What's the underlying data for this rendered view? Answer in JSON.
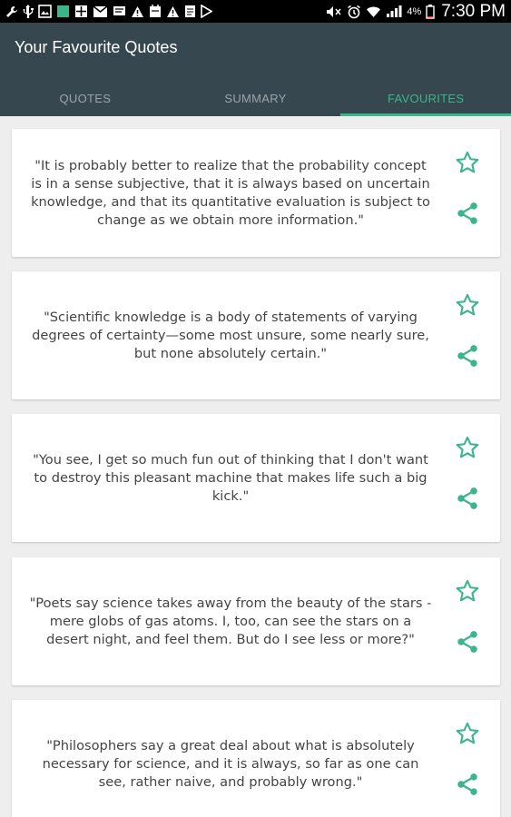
{
  "status_bar": {
    "battery": "4%",
    "time": "7:30 PM"
  },
  "app": {
    "title": "Your Favourite Quotes"
  },
  "tabs": [
    {
      "label": "QUOTES",
      "active": false
    },
    {
      "label": "SUMMARY",
      "active": false
    },
    {
      "label": "FAVOURITES",
      "active": true
    }
  ],
  "colors": {
    "appbar": "#37474f",
    "accent": "#3db58a"
  },
  "quotes": [
    {
      "text": "\"It is probably better to realize that the probability concept is in a sense subjective, that it is always based on uncertain knowledge, and that its quantitative evaluation is subject to change as we obtain more information.\"",
      "favourite_icon": "star-outline-icon",
      "share_icon": "share-icon"
    },
    {
      "text": "\"Scientific knowledge is a body of statements of varying degrees of certainty—some most unsure, some nearly sure, but none absolutely certain.\"",
      "favourite_icon": "star-outline-icon",
      "share_icon": "share-icon"
    },
    {
      "text": "\"You see, I get so much fun out of thinking that I don't want to destroy this pleasant machine that makes life such a big kick.\"",
      "favourite_icon": "star-outline-icon",
      "share_icon": "share-icon"
    },
    {
      "text": "\"Poets say science takes away from the beauty of the stars - mere globs of gas atoms. I, too, can see the stars on a desert night, and feel them. But do I see less or more?\"",
      "favourite_icon": "star-outline-icon",
      "share_icon": "share-icon"
    },
    {
      "text": "\"Philosophers say a great deal about what is absolutely necessary for science, and it is always, so far as one can see, rather naive, and probably wrong.\"",
      "favourite_icon": "star-outline-icon",
      "share_icon": "share-icon"
    }
  ]
}
